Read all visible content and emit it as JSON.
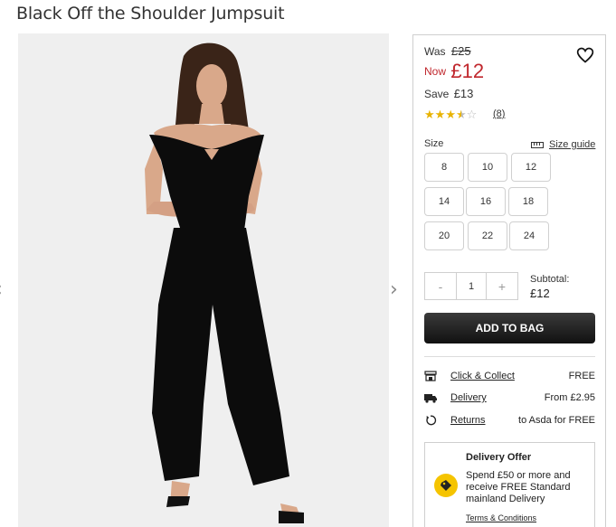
{
  "product": {
    "title": "Black Off the Shoulder Jumpsuit"
  },
  "price": {
    "was_label": "Was",
    "was_value": "£25",
    "now_label": "Now",
    "now_value": "£12",
    "save_label": "Save",
    "save_value": "£13"
  },
  "rating": {
    "stars": 3.5,
    "max": 5,
    "review_count": "(8)"
  },
  "size": {
    "label": "Size",
    "guide_label": "Size guide",
    "options": [
      "8",
      "10",
      "12",
      "14",
      "16",
      "18",
      "20",
      "22",
      "24"
    ]
  },
  "quantity": {
    "minus": "-",
    "value": "1",
    "plus": "+"
  },
  "subtotal": {
    "label": "Subtotal:",
    "value": "£12"
  },
  "add_to_bag": "ADD TO BAG",
  "delivery": [
    {
      "icon": "store-icon",
      "label": "Click & Collect",
      "value": "FREE"
    },
    {
      "icon": "truck-icon",
      "label": "Delivery",
      "value": "From £2.95"
    },
    {
      "icon": "return-icon",
      "label": "Returns",
      "value": "to Asda for FREE"
    }
  ],
  "offer": {
    "title": "Delivery Offer",
    "text": "Spend £50 or more and receive FREE Standard mainland Delivery",
    "terms": "Terms & Conditions"
  },
  "colors": {
    "price_red": "#c0272d",
    "star_gold": "#e8b300",
    "button_dark": "#1a1a1a",
    "offer_yellow": "#f5c400"
  }
}
